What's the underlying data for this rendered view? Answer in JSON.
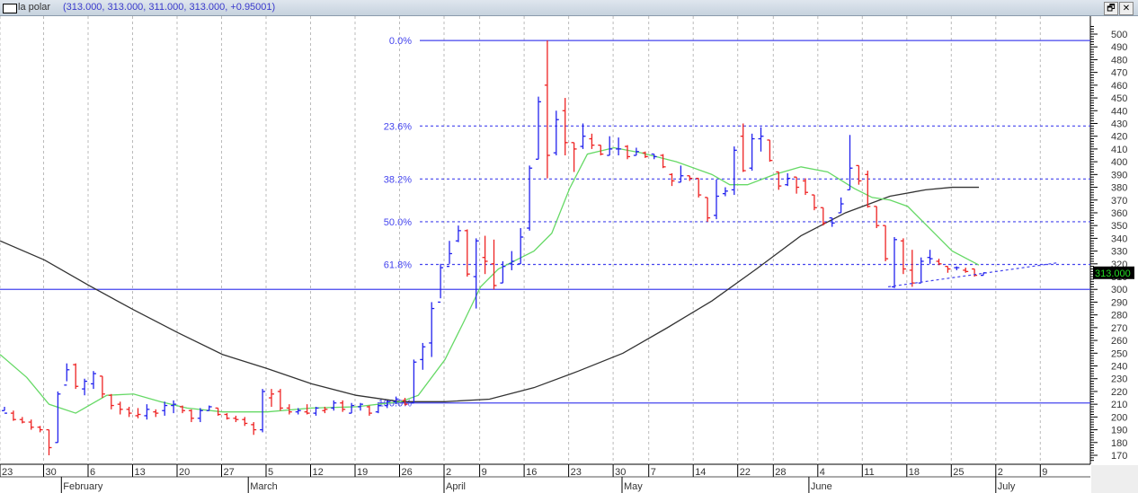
{
  "window": {
    "title_name": "la polar",
    "title_values": "(313.000, 313.000, 311.000, 313.000, +0.95001)",
    "restore_icon": "restore-icon",
    "close_icon": "close-icon",
    "restore_label": "🗗",
    "close_label": "✕"
  },
  "colors": {
    "up": "#2222ee",
    "down": "#ee2222",
    "ma_short": "#66d966",
    "ma_long": "#333333",
    "fib": "#4444ee",
    "price_badge_bg": "#000000",
    "price_badge_fg": "#22dd22"
  },
  "chart_data": {
    "type": "ohlc",
    "symbol": "la polar",
    "last_price_label": "313.000",
    "ylim": [
      165,
      505
    ],
    "y_ticks": [
      170,
      180,
      190,
      200,
      210,
      220,
      230,
      240,
      250,
      260,
      270,
      280,
      290,
      300,
      310,
      320,
      330,
      340,
      350,
      360,
      370,
      380,
      390,
      400,
      410,
      420,
      430,
      440,
      450,
      460,
      470,
      480,
      490,
      500
    ],
    "x_week_ticks": [
      {
        "label": "23",
        "bar": 0
      },
      {
        "label": "30",
        "bar": 5
      },
      {
        "label": "6",
        "bar": 10
      },
      {
        "label": "13",
        "bar": 15
      },
      {
        "label": "20",
        "bar": 20
      },
      {
        "label": "27",
        "bar": 25
      },
      {
        "label": "5",
        "bar": 30
      },
      {
        "label": "12",
        "bar": 35
      },
      {
        "label": "19",
        "bar": 40
      },
      {
        "label": "26",
        "bar": 45
      },
      {
        "label": "2",
        "bar": 50
      },
      {
        "label": "9",
        "bar": 54
      },
      {
        "label": "16",
        "bar": 59
      },
      {
        "label": "23",
        "bar": 64
      },
      {
        "label": "30",
        "bar": 69
      },
      {
        "label": "7",
        "bar": 73
      },
      {
        "label": "14",
        "bar": 78
      },
      {
        "label": "22",
        "bar": 83
      },
      {
        "label": "28",
        "bar": 87
      },
      {
        "label": "4",
        "bar": 92
      },
      {
        "label": "11",
        "bar": 97
      },
      {
        "label": "18",
        "bar": 102
      },
      {
        "label": "25",
        "bar": 107
      },
      {
        "label": "2",
        "bar": 112
      },
      {
        "label": "9",
        "bar": 117
      }
    ],
    "x_month_ticks": [
      {
        "label": "February",
        "bar": 7
      },
      {
        "label": "March",
        "bar": 28
      },
      {
        "label": "April",
        "bar": 50
      },
      {
        "label": "May",
        "bar": 70
      },
      {
        "label": "June",
        "bar": 91
      },
      {
        "label": "July",
        "bar": 112
      }
    ],
    "fibonacci": {
      "high": 495,
      "low": 211,
      "levels": [
        {
          "label": "0.0%",
          "value": 495,
          "style": "solid"
        },
        {
          "label": "23.6%",
          "value": 428,
          "style": "dashed"
        },
        {
          "label": "38.2%",
          "value": 386.5,
          "style": "dashed"
        },
        {
          "label": "50.0%",
          "value": 353,
          "style": "dashed"
        },
        {
          "label": "61.8%",
          "value": 319.5,
          "style": "dashed"
        },
        {
          "label": "100.0%",
          "value": 211,
          "style": "solid"
        }
      ]
    },
    "support_line": 300,
    "trendline": {
      "from": [
        99.3,
        302
      ],
      "to": [
        118.5,
        321
      ]
    },
    "bars_ohlc": [
      [
        205,
        208,
        205,
        203
      ],
      [
        203,
        205,
        197,
        198
      ],
      [
        198,
        200,
        195,
        196
      ],
      [
        196,
        198,
        190,
        192
      ],
      [
        192,
        193,
        188,
        190
      ],
      [
        190,
        190,
        170,
        176
      ],
      [
        180,
        220,
        180,
        218
      ],
      [
        225,
        242,
        228,
        237
      ],
      [
        241,
        242,
        222,
        224
      ],
      [
        222,
        230,
        217,
        228
      ],
      [
        226,
        236,
        222,
        234
      ],
      [
        232,
        232,
        215,
        218
      ],
      [
        217,
        218,
        206,
        209
      ],
      [
        210,
        212,
        202,
        206
      ],
      [
        206,
        208,
        200,
        203
      ],
      [
        201,
        207,
        199,
        202
      ],
      [
        201,
        210,
        198,
        206
      ],
      [
        204,
        206,
        200,
        203
      ],
      [
        205,
        212,
        201,
        209
      ],
      [
        209,
        213,
        203,
        210
      ],
      [
        208,
        209,
        203,
        205
      ],
      [
        205,
        206,
        196,
        199
      ],
      [
        199,
        207,
        196,
        205
      ],
      [
        205,
        209,
        205,
        208
      ],
      [
        207,
        207,
        201,
        202
      ],
      [
        202,
        203,
        198,
        199
      ],
      [
        199,
        201,
        196,
        198
      ],
      [
        198,
        200,
        193,
        195
      ],
      [
        194,
        196,
        186,
        190
      ],
      [
        190,
        222,
        188,
        220
      ],
      [
        215,
        222,
        208,
        218
      ],
      [
        220,
        222,
        205,
        207
      ],
      [
        207,
        210,
        202,
        204
      ],
      [
        204,
        207,
        202,
        205
      ],
      [
        204,
        210,
        202,
        203
      ],
      [
        203,
        208,
        201,
        207
      ],
      [
        205,
        208,
        203,
        206
      ],
      [
        207,
        213,
        205,
        211
      ],
      [
        211,
        213,
        204,
        206
      ],
      [
        203,
        211,
        203,
        209
      ],
      [
        208,
        211,
        205,
        210
      ],
      [
        208,
        209,
        201,
        203
      ],
      [
        204,
        210,
        203,
        209
      ],
      [
        209,
        213,
        207,
        212
      ],
      [
        212,
        216,
        210,
        214
      ],
      [
        213,
        215,
        209,
        210
      ],
      [
        211,
        245,
        211,
        243
      ],
      [
        245,
        258,
        237,
        255
      ],
      [
        258,
        290,
        247,
        285
      ],
      [
        290,
        320,
        293,
        317
      ],
      [
        318,
        338,
        320,
        328
      ],
      [
        338,
        350,
        337,
        346
      ],
      [
        346,
        347,
        310,
        312
      ],
      [
        310,
        340,
        285,
        338
      ],
      [
        325,
        342,
        312,
        322
      ],
      [
        320,
        339,
        300,
        303
      ],
      [
        305,
        322,
        305,
        318
      ],
      [
        320,
        330,
        315,
        322
      ],
      [
        320,
        348,
        320,
        341
      ],
      [
        348,
        397,
        346,
        395
      ],
      [
        402,
        451,
        402,
        447
      ],
      [
        460,
        495,
        387,
        405
      ],
      [
        407,
        440,
        405,
        433
      ],
      [
        440,
        450,
        405,
        415
      ],
      [
        415,
        415,
        392,
        410
      ],
      [
        412,
        430,
        410,
        420
      ],
      [
        418,
        422,
        410,
        413
      ],
      [
        413,
        413,
        405,
        406
      ],
      [
        405,
        420,
        405,
        410
      ],
      [
        410,
        419,
        405,
        410
      ],
      [
        412,
        413,
        402,
        404
      ],
      [
        405,
        411,
        405,
        408
      ],
      [
        407,
        408,
        403,
        404
      ],
      [
        406,
        406,
        402,
        404
      ],
      [
        405,
        406,
        395,
        396
      ],
      [
        390,
        391,
        381,
        385
      ],
      [
        384,
        397,
        384,
        389
      ],
      [
        389,
        389,
        385,
        387
      ],
      [
        387,
        387,
        372,
        374
      ],
      [
        372,
        372,
        353,
        356
      ],
      [
        358,
        386,
        355,
        373
      ],
      [
        375,
        380,
        373,
        377
      ],
      [
        378,
        412,
        374,
        409
      ],
      [
        420,
        430,
        392,
        393
      ],
      [
        395,
        422,
        393,
        418
      ],
      [
        418,
        427,
        408,
        420
      ],
      [
        417,
        417,
        400,
        401
      ],
      [
        392,
        392,
        378,
        381
      ],
      [
        382,
        391,
        381,
        387
      ],
      [
        388,
        388,
        375,
        380
      ],
      [
        385,
        387,
        374,
        376
      ],
      [
        374,
        374,
        362,
        364
      ],
      [
        364,
        364,
        350,
        352
      ],
      [
        356,
        356,
        349,
        352
      ],
      [
        360,
        372,
        360,
        367
      ],
      [
        378,
        421,
        378,
        395
      ],
      [
        397,
        397,
        382,
        385
      ],
      [
        390,
        393,
        364,
        365
      ],
      [
        365,
        365,
        348,
        350
      ],
      [
        350,
        350,
        322,
        324
      ],
      [
        302,
        341,
        301,
        339
      ],
      [
        338,
        340,
        312,
        316
      ],
      [
        315,
        331,
        302,
        305
      ],
      [
        305,
        325,
        305,
        322
      ],
      [
        325,
        331,
        320,
        324
      ],
      [
        322,
        324,
        319,
        320
      ],
      [
        318,
        318,
        313,
        316
      ],
      [
        317,
        318,
        315,
        317
      ],
      [
        315,
        317,
        313,
        314
      ],
      [
        316,
        316,
        310,
        311
      ],
      [
        311,
        313,
        311,
        313
      ]
    ],
    "ma_short": [
      [
        -0.5,
        249
      ],
      [
        2.5,
        231
      ],
      [
        5,
        210
      ],
      [
        8,
        203
      ],
      [
        11.5,
        217
      ],
      [
        14.5,
        218
      ],
      [
        17.5,
        212
      ],
      [
        20.5,
        207
      ],
      [
        24.5,
        204
      ],
      [
        29.5,
        204
      ],
      [
        34.5,
        207
      ],
      [
        39.5,
        208
      ],
      [
        44.5,
        212
      ],
      [
        46.5,
        217
      ],
      [
        49.5,
        245
      ],
      [
        51.5,
        273
      ],
      [
        53.5,
        302
      ],
      [
        55.5,
        316
      ],
      [
        57.5,
        323
      ],
      [
        59.5,
        330
      ],
      [
        61.5,
        344
      ],
      [
        63.5,
        379
      ],
      [
        65.5,
        406
      ],
      [
        68.5,
        411
      ],
      [
        71.5,
        407
      ],
      [
        75.5,
        400
      ],
      [
        79.5,
        390
      ],
      [
        81.5,
        382
      ],
      [
        83.5,
        382
      ],
      [
        86.5,
        390
      ],
      [
        89.5,
        396
      ],
      [
        92.5,
        392
      ],
      [
        95.5,
        379
      ],
      [
        97.5,
        372
      ],
      [
        99.5,
        370
      ],
      [
        101.5,
        365
      ],
      [
        104.5,
        344
      ],
      [
        106.5,
        330
      ],
      [
        109.5,
        319
      ]
    ],
    "ma_long": [
      [
        -0.5,
        338
      ],
      [
        4.5,
        323
      ],
      [
        9.5,
        303
      ],
      [
        14.5,
        284
      ],
      [
        19.5,
        266
      ],
      [
        24.5,
        249
      ],
      [
        29.5,
        238
      ],
      [
        34.5,
        226
      ],
      [
        39.5,
        217
      ],
      [
        44.5,
        212
      ],
      [
        49.5,
        212
      ],
      [
        54.5,
        214
      ],
      [
        59.5,
        223
      ],
      [
        64.5,
        236
      ],
      [
        69.5,
        250
      ],
      [
        74.5,
        270
      ],
      [
        79.5,
        291
      ],
      [
        84.5,
        316
      ],
      [
        89.5,
        342
      ],
      [
        94.5,
        360
      ],
      [
        99.5,
        373
      ],
      [
        103.5,
        378
      ],
      [
        106.5,
        380
      ],
      [
        109.5,
        380
      ]
    ]
  }
}
